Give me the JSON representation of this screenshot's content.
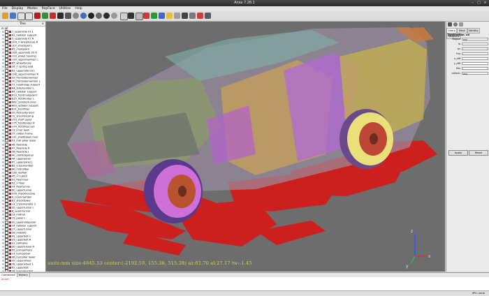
{
  "app": {
    "title": "Ansa 7.26.1"
  },
  "menu": [
    "File",
    "Display",
    "Modes",
    "RepFace",
    "Utilities",
    "Help"
  ],
  "toolbar_icons": [
    "open-icon",
    "save-icon",
    "undo-icon",
    "redo-icon",
    "grid-icon",
    "wireframe-icon",
    "shaded-icon",
    "zoom-icon",
    "pan-icon",
    "rotate-icon",
    "fit-icon",
    "view-front-icon",
    "view-side-icon",
    "view-top-icon",
    "view-iso-icon",
    "pick-icon",
    "select-icon",
    "measure-icon",
    "cut-icon",
    "color-icon",
    "section-icon",
    "light-icon",
    "transparency-icon",
    "camera-icon",
    "settings-icon",
    "probe-icon",
    "help-icon"
  ],
  "tree": {
    "header": "Tree",
    "root": "⊟ all",
    "items": [
      "1_upperside 01 L",
      "61_radiator support",
      "3_upperside 01 R",
      "104_rl wheelhouse R",
      "107_shockpad L",
      "65_mudguard",
      "106_upperside 02 R",
      "113_wheel housing",
      "139_uppermember L",
      "65_wheelhouse",
      "26_rr spring seat",
      "63_upperside 03 L",
      "138_uppermember R",
      "59_frontsidemember",
      "70_frontsidemember L",
      "71_hoodhinge support",
      "64_sidemember L",
      "69_radiator support",
      "614_frontmudguard",
      "615_frontfender L",
      "662_cylindertunnel",
      "663_radiator support",
      "621_frontfloor",
      "29_floorextension",
      "72_shockhousing",
      "173_shelf panel",
      "175_frontfender R",
      "174_frontfloor ext",
      "73_inner dash",
      "27_rollbar frame",
      "131_shelfpanel inner",
      "53_mdr pillar lower",
      "48_floorside",
      "47_floorside R",
      "28_floorside L",
      "40_roofsidepanel",
      "44_upperpanel",
      "67_upperpanel L",
      "85_crossmember",
      "66_midrollbar",
      "130_roofrail",
      "45_rr cutout",
      "51_floorinner",
      "52_rr floor",
      "54_floortunnel",
      "60_uppertunnel",
      "516_shockhousing",
      "9_crossmember",
      "61_shocktower",
      "11_crossmember 2",
      "35_uppertunnel L",
      "8_uppertunnel",
      "13_midrail",
      "19_panel L",
      "20_uppersidepanel",
      "24_radiator support",
      "27_uppertunnel",
      "26_midside",
      "41_upperbelt L",
      "23_upperbelt R",
      "22_rollframe",
      "30_uppertunnel R",
      "55_bumperfront",
      "17_bumperbar",
      "36_bumpbar lower",
      "39_upperwheel",
      "28_upperwheel L",
      "62_upperbelt",
      "38_bumpbracket",
      "31_bumperbar R",
      "58_bumperbar 2",
      "54_radiatorsupport"
    ]
  },
  "viewport": {
    "status": "units:mm  size:4945.53  center:(-2192.59, 155.38, 515.38) az:62.70  el:27.17  tw:-1.45",
    "axis_labels": {
      "x": "x",
      "y": "y",
      "z": "z"
    }
  },
  "right_panel": {
    "tabs": [
      "Interp",
      "Mesh",
      "Identity",
      "Relations"
    ],
    "active_tab": "Interp",
    "destination_label": "Destination: all",
    "fields": [
      {
        "label": "Region",
        "value": "any"
      },
      {
        "label": "Id",
        "value": ""
      },
      {
        "label": "Ac",
        "value": ""
      },
      {
        "label": "Fsn",
        "value": ""
      },
      {
        "label": "x_diff",
        "value": ""
      },
      {
        "label": "y_diff",
        "value": ""
      },
      {
        "label": "Min",
        "value": ""
      },
      {
        "label": "collectr",
        "value": "any"
      }
    ],
    "apply_label": "Apply",
    "reset_label": "Reset"
  },
  "console": {
    "tabs": [
      "Command",
      "History"
    ],
    "active_tab": "Command",
    "prompt": "Ansa> "
  },
  "bottom_status": "0Pn: none",
  "colors": {
    "accent_red": "#d41b1b",
    "viewport_bg": "#6d6d6d",
    "status_text": "#d9d94a"
  }
}
